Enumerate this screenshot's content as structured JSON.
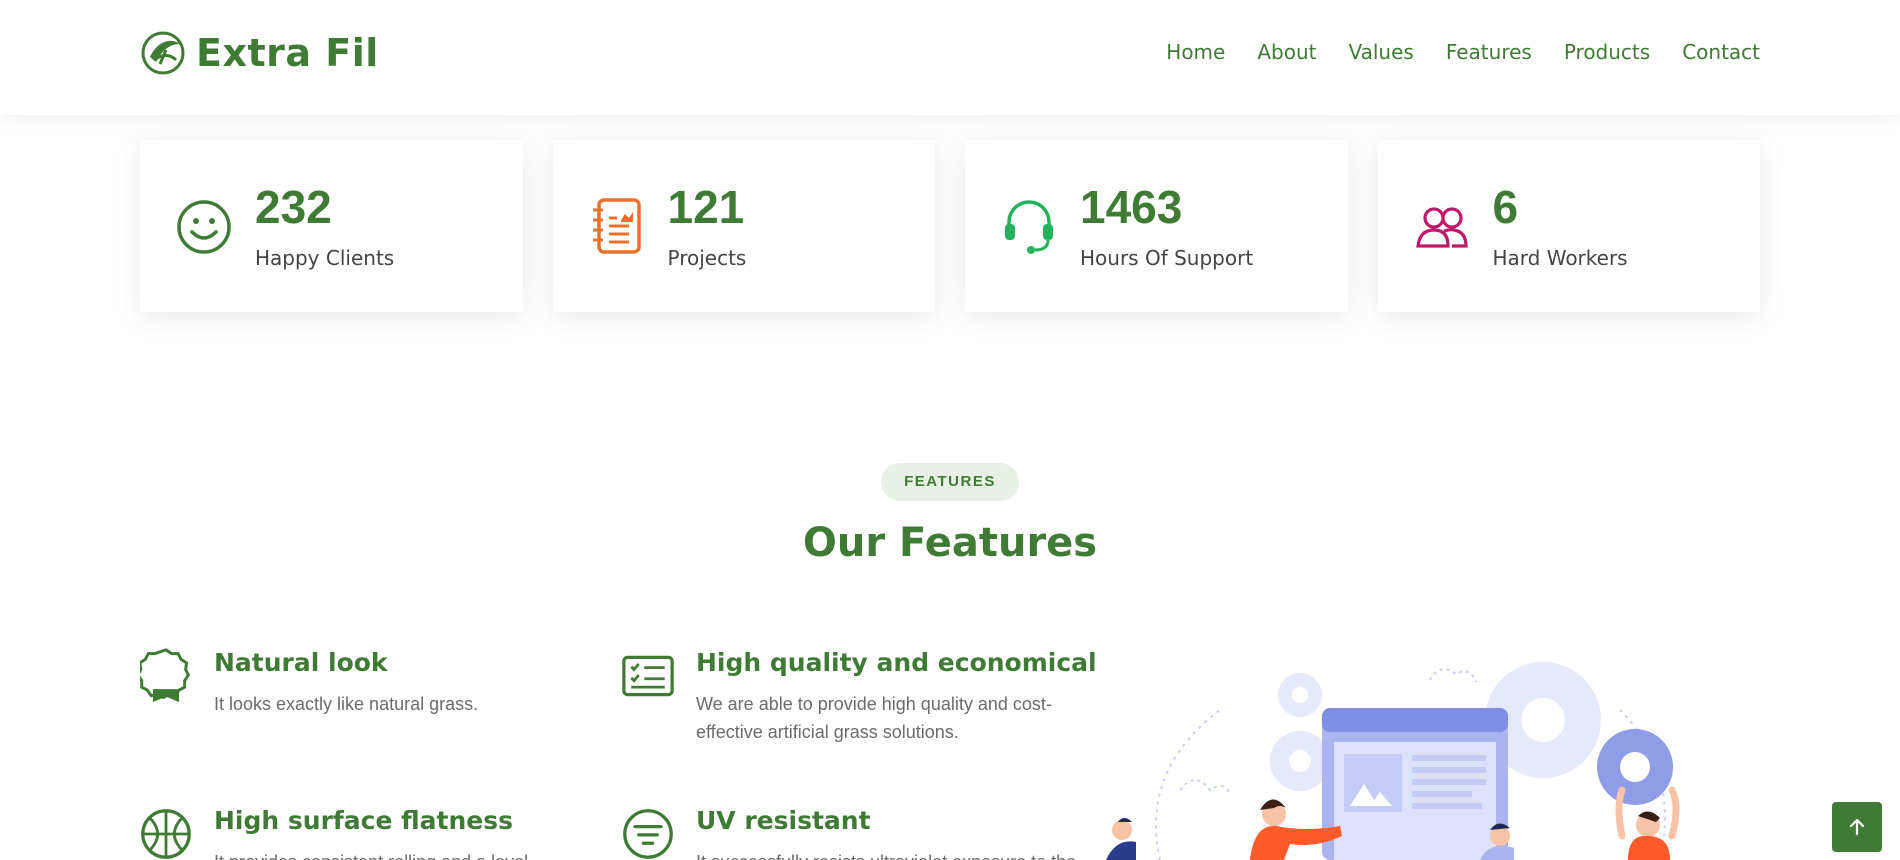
{
  "brand": {
    "name": "Extra Fil",
    "color": "#3f7b34"
  },
  "nav": {
    "items": [
      {
        "label": "Home"
      },
      {
        "label": "About"
      },
      {
        "label": "Values"
      },
      {
        "label": "Features"
      },
      {
        "label": "Products"
      },
      {
        "label": "Contact"
      }
    ]
  },
  "stats": [
    {
      "value": "232",
      "label": "Happy Clients",
      "icon": "smile-icon",
      "color": "#3f7b34"
    },
    {
      "value": "121",
      "label": "Projects",
      "icon": "journal-icon",
      "color": "#e8712b"
    },
    {
      "value": "1463",
      "label": "Hours Of Support",
      "icon": "headset-icon",
      "color": "#22b35a"
    },
    {
      "value": "6",
      "label": "Hard Workers",
      "icon": "people-icon",
      "color": "#c0186a"
    }
  ],
  "features_section": {
    "badge": "FEATURES",
    "title": "Our Features",
    "items": [
      {
        "title": "Natural look",
        "text": "It looks exactly like natural grass.",
        "icon": "award-icon"
      },
      {
        "title": "High quality and economical",
        "text": "We are able to provide high quality and cost-effective artificial grass solutions.",
        "icon": "checklist-icon"
      },
      {
        "title": "High surface flatness",
        "text": "It provides consistent rolling and a level",
        "icon": "basketball-icon"
      },
      {
        "title": "UV resistant",
        "text": "It successfully resists ultraviolet exposure to the",
        "icon": "filter-icon"
      }
    ]
  },
  "scroll_top": {
    "icon": "arrow-up-icon"
  }
}
